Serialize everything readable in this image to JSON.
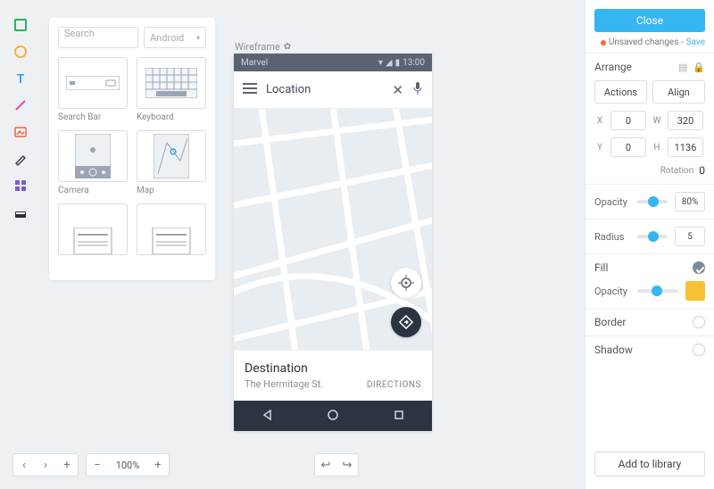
{
  "library": {
    "search_placeholder": "Search",
    "platform": "Android",
    "items": [
      {
        "label": "Search Bar"
      },
      {
        "label": "Keyboard"
      },
      {
        "label": "Camera"
      },
      {
        "label": "Map"
      },
      {
        "label": ""
      },
      {
        "label": ""
      }
    ]
  },
  "canvas": {
    "frame_label": "Wireframe",
    "statusbar": {
      "title": "Marvel",
      "time": "13:00"
    },
    "search": {
      "label": "Location"
    },
    "destination": {
      "title": "Destination",
      "subtitle": "The Hermitage St.",
      "directions": "DIRECTIONS"
    }
  },
  "inspector": {
    "close": "Close",
    "unsaved": "Unsaved changes -",
    "save": "Save",
    "arrange": {
      "title": "Arrange",
      "actions": "Actions",
      "align": "Align",
      "x_label": "X",
      "x": "0",
      "y_label": "Y",
      "y": "0",
      "w_label": "W",
      "w": "320",
      "h_label": "H",
      "h": "1136",
      "rotation_label": "Rotation",
      "rotation": "0"
    },
    "opacity": {
      "label": "Opacity",
      "value": "80%",
      "knob_pct": 35
    },
    "radius": {
      "label": "Radius",
      "value": "5",
      "knob_pct": 35
    },
    "fill": {
      "label": "Fill",
      "opacity_label": "Opacity",
      "color": "#f8c034",
      "knob_pct": 35
    },
    "border": {
      "label": "Border"
    },
    "shadow": {
      "label": "Shadow"
    },
    "add_to_library": "Add to library"
  },
  "bottom": {
    "zoom": "100%"
  }
}
